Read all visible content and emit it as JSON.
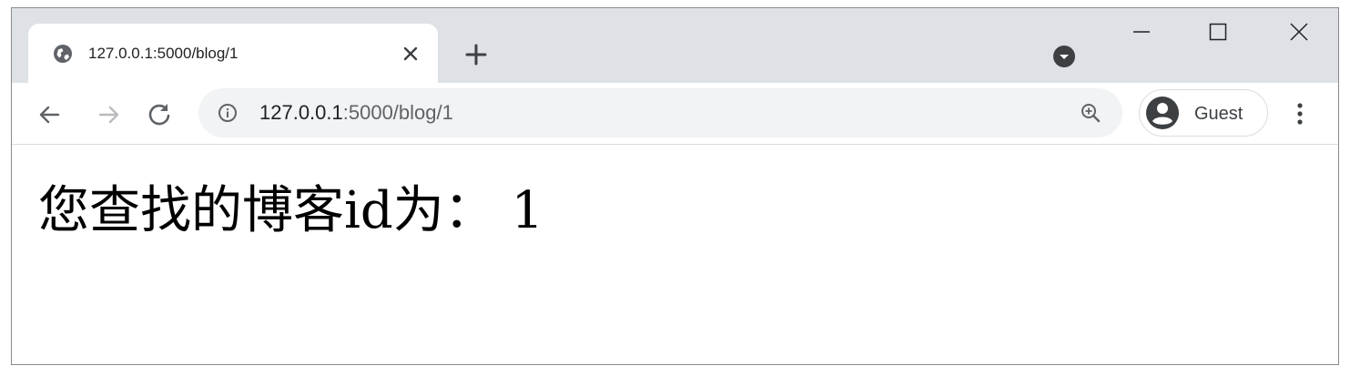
{
  "browser": {
    "tab": {
      "title": "127.0.0.1:5000/blog/1",
      "favicon": "globe-icon"
    },
    "address_bar": {
      "url_host": "127.0.0.1",
      "url_path": ":5000/blog/1"
    },
    "profile": {
      "label": "Guest"
    }
  },
  "page": {
    "heading": "您查找的博客id为： 1"
  },
  "colors": {
    "tabstrip_bg": "#dee1e6",
    "omnibox_bg": "#f1f3f4",
    "icon": "#5f6368",
    "text": "#202124"
  }
}
